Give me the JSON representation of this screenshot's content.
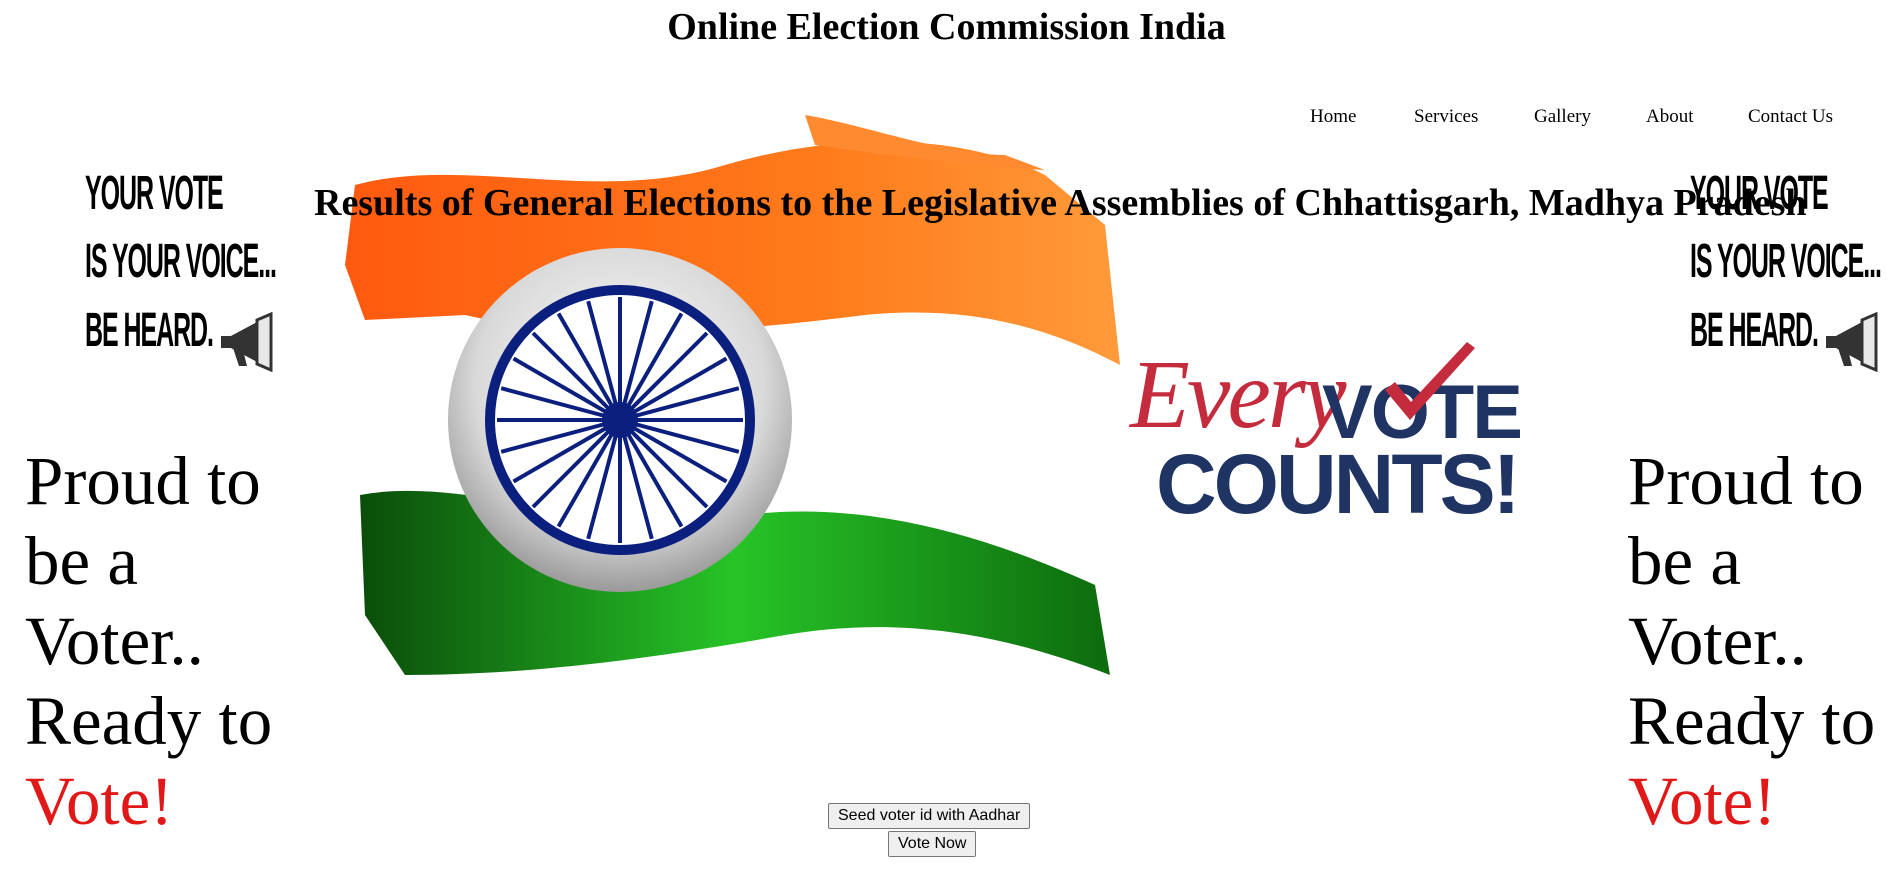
{
  "header": {
    "title": "Online Election Commission India"
  },
  "nav": {
    "items": [
      "Home",
      "Services",
      "Gallery",
      "About",
      "Contact Us"
    ]
  },
  "announcement": "Results of General Elections to the Legislative Assemblies of Chhattisgarh, Madhya Pradesh",
  "poster_voice": {
    "lines": [
      "YOUR VOTE",
      "IS YOUR VOICE...",
      "BE HEARD."
    ]
  },
  "poster_proud": {
    "lines": [
      "Proud to",
      "be a",
      "Voter..",
      "Ready to"
    ],
    "highlight_first": "V",
    "highlight_rest": "ote!",
    "accent_color": "#e01818"
  },
  "badge": {
    "every": "Every",
    "vote": "VOTE",
    "counts": "COUNTS!",
    "red": "#c42b3c",
    "navy": "#1f3463"
  },
  "flag": {
    "saffron": "#ff6a13",
    "green": "#1a9d1a",
    "chakra": "#0b1f7e"
  },
  "buttons": {
    "seed": "Seed voter id with Aadhar",
    "vote": "Vote Now"
  }
}
